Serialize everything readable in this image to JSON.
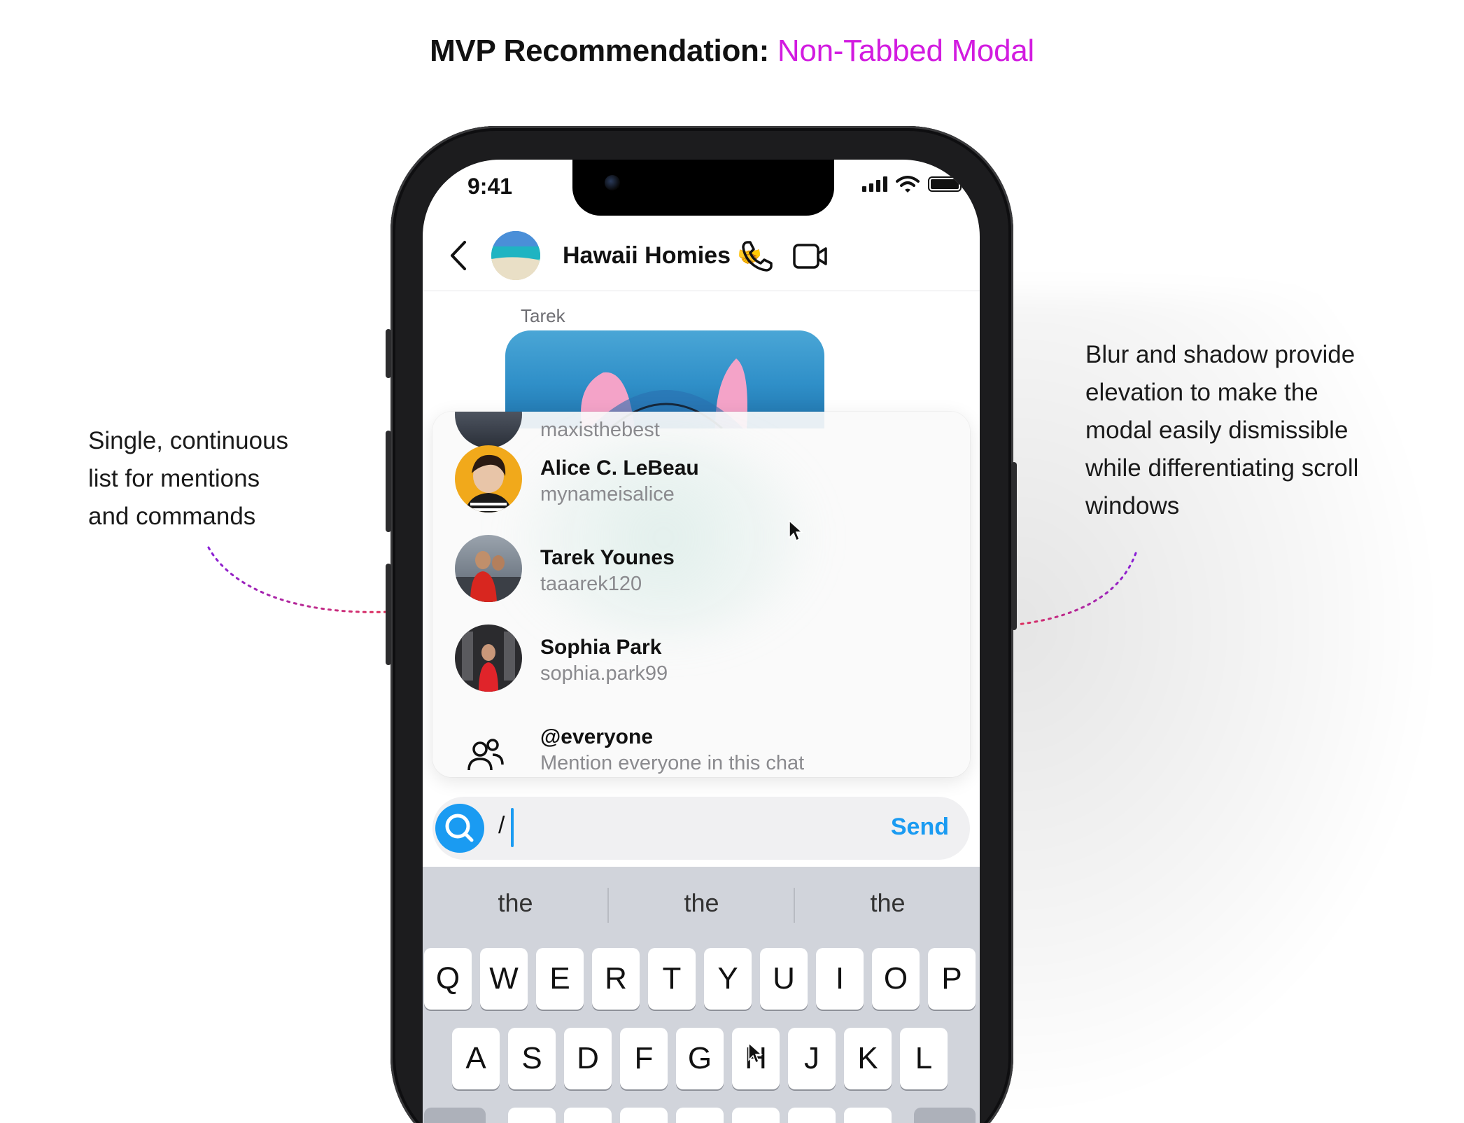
{
  "heading": {
    "prefix": "MVP Recommendation:",
    "accent": "Non-Tabbed Modal",
    "accent_color": "#d21be0"
  },
  "annotations": {
    "left": [
      "Single, continuous",
      "list for mentions",
      "and commands"
    ],
    "right": [
      "Blur and shadow provide",
      "elevation to make the",
      "modal easily dismissible",
      "while differentiating scroll",
      "windows"
    ]
  },
  "status_bar": {
    "time": "9:41"
  },
  "chat": {
    "title": "Hawaii Homies",
    "title_emoji": "🤝",
    "sender_label": "Tarek"
  },
  "mentions": [
    {
      "name": "",
      "handle": "maxisthebest"
    },
    {
      "name": "Alice C. LeBeau",
      "handle": "mynameisalice"
    },
    {
      "name": "Tarek Younes",
      "handle": "taaarek120"
    },
    {
      "name": "Sophia Park",
      "handle": "sophia.park99"
    },
    {
      "name": "@everyone",
      "handle": "Mention everyone in this chat"
    }
  ],
  "composer": {
    "value": "/",
    "send_label": "Send",
    "accent_color": "#1a9bf2"
  },
  "keyboard": {
    "suggestions": [
      "the",
      "the",
      "the"
    ],
    "row1": [
      "Q",
      "W",
      "E",
      "R",
      "T",
      "Y",
      "U",
      "I",
      "O",
      "P"
    ],
    "row2": [
      "A",
      "S",
      "D",
      "F",
      "G",
      "H",
      "J",
      "K",
      "L"
    ]
  }
}
